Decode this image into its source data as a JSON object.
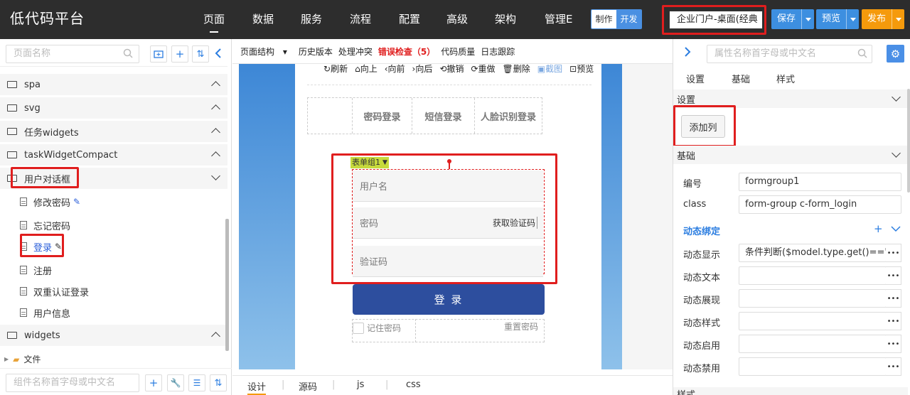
{
  "app": {
    "title": "低代码平台"
  },
  "nav": [
    {
      "label": "页面"
    },
    {
      "label": "数据"
    },
    {
      "label": "服务"
    },
    {
      "label": "流程"
    },
    {
      "label": "配置"
    },
    {
      "label": "高级"
    },
    {
      "label": "架构"
    },
    {
      "label": "管理E"
    }
  ],
  "mode": {
    "make": "制作",
    "dev": "开发"
  },
  "page_selector": {
    "value": "企业门户-桌面(经典"
  },
  "actions": {
    "save": "保存",
    "preview": "预览",
    "publish": "发布"
  },
  "left": {
    "search_placeholder": "页面名称",
    "groups": [
      {
        "label": "spa"
      },
      {
        "label": "svg"
      },
      {
        "label": "任务widgets"
      },
      {
        "label": "taskWidgetCompact"
      },
      {
        "label": "用户对话框"
      }
    ],
    "items": [
      {
        "label": "修改密码"
      },
      {
        "label": "忘记密码"
      },
      {
        "label": "登录"
      },
      {
        "label": "注册"
      },
      {
        "label": "双重认证登录"
      },
      {
        "label": "用户信息"
      }
    ],
    "widgets_group": "widgets",
    "files_label": "文件",
    "component_search_placeholder": "组件名称首字母或中文名"
  },
  "toolbar": {
    "structure": "页面结构",
    "history": "历史版本",
    "conflict": "处理冲突",
    "errors": "错误检查（5）",
    "quality": "代码质量",
    "log": "日志跟踪"
  },
  "canvas_tools": {
    "refresh": "刷新",
    "up": "向上",
    "forward": "向前",
    "back": "向后",
    "undo": "撤销",
    "redo": "重做",
    "delete": "删除",
    "shot": "截图",
    "preview": "预览"
  },
  "login_tabs": [
    "密码登录",
    "短信登录",
    "人脸识别登录"
  ],
  "formgroup_tag": "表单组1",
  "form": {
    "username": "用户名",
    "password": "密码",
    "get_code": "获取验证码",
    "code": "验证码",
    "submit": "登 录",
    "remember": "记住密码",
    "reset": "重置密码"
  },
  "bottom_tabs": [
    "设计",
    "源码",
    "js",
    "css"
  ],
  "right": {
    "search_placeholder": "属性名称首字母或中文名",
    "tabs": [
      "设置",
      "基础",
      "样式"
    ],
    "settings_header": "设置",
    "add_column": "添加列",
    "basic_header": "基础",
    "props": [
      {
        "label": "编号",
        "value": "formgroup1"
      },
      {
        "label": "class",
        "value": "form-group  c-form_login"
      }
    ],
    "dyn_header": "动态绑定",
    "dyn_props": [
      {
        "label": "动态显示",
        "value": "条件判断($model.type.get()=='pa"
      },
      {
        "label": "动态文本",
        "value": ""
      },
      {
        "label": "动态展现",
        "value": ""
      },
      {
        "label": "动态样式",
        "value": ""
      },
      {
        "label": "动态启用",
        "value": ""
      },
      {
        "label": "动态禁用",
        "value": ""
      }
    ],
    "style_header": "样式"
  }
}
